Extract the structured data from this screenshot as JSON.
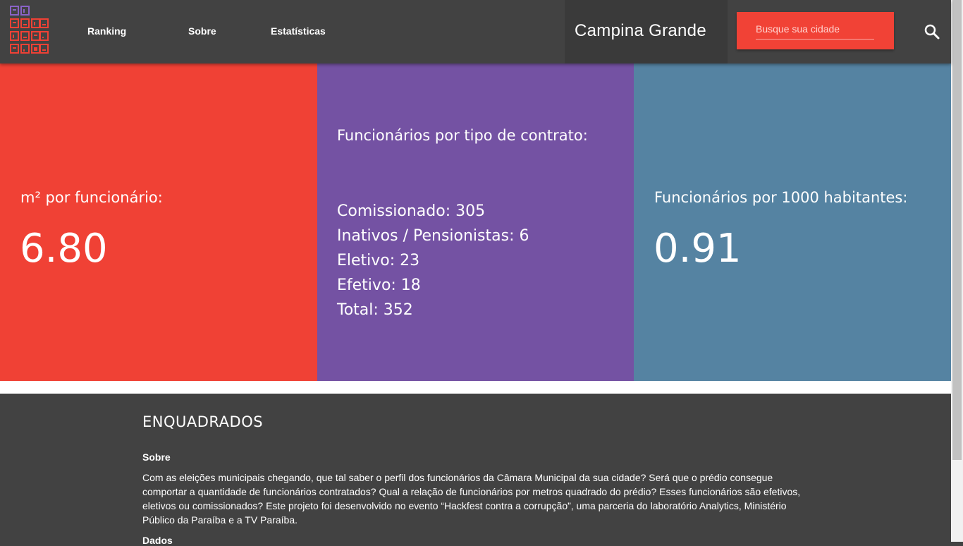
{
  "header": {
    "logo_text": "ENQUADRADOS",
    "nav": [
      "Ranking",
      "Sobre",
      "Estatísticas"
    ],
    "city": "Campina Grande",
    "search": {
      "placeholder": "Busque sua cidade",
      "value": ""
    },
    "search_icon": "search-icon"
  },
  "panels": {
    "area": {
      "label": "m² por funcionário:",
      "value": "6.80"
    },
    "contracts": {
      "title": "Funcionários por tipo de contrato:",
      "items": [
        "Comissionado: 305",
        "Inativos / Pensionistas: 6",
        "Eletivo: 23",
        "Efetivo: 18",
        "Total: 352"
      ]
    },
    "per_capita": {
      "label": "Funcionários por 1000 habitantes:",
      "value": "0.91"
    }
  },
  "footer": {
    "title": "ENQUADRADOS",
    "subtitle": "Sobre",
    "text": "Com as eleições municipais chegando, que tal saber o perfil dos funcionários da Câmara Municipal da sua cidade? Será que o prédio consegue comportar a quantidade de funcionários contratados? Qual a relação de funcionários por metros quadrado do prédio? Esses funcionários são efetivos, eletivos ou comissionados? Este projeto foi desenvolvido no evento “Hackfest contra a corrupção”, uma parceria do laboratório Analytics, Ministério Público da Paraíba e a TV Paraíba.",
    "subtitle2": "Dados"
  },
  "colors": {
    "header_bg": "#424242",
    "red": "#f04135",
    "purple": "#7452a3",
    "blue": "#5583a2",
    "search_bg": "#f14236"
  }
}
